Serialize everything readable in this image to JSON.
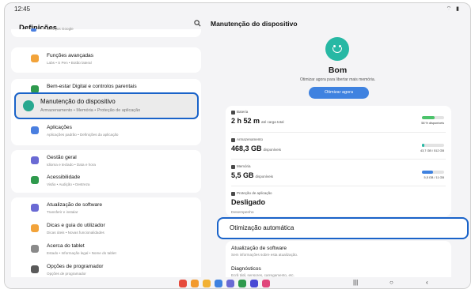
{
  "status_bar": {
    "time": "12:45",
    "icons": "⌔ ▮"
  },
  "left": {
    "title": "Definições",
    "search_icon": "search-icon",
    "items": [
      {
        "title": "",
        "subtitle": "Serviços Google",
        "color": "#4a7fe0"
      },
      {
        "title": "Funções avançadas",
        "subtitle": "Labs • S Pen • Botão lateral",
        "color": "#f2a33a"
      },
      {
        "title": "Bem-estar Digital e controlos parentais",
        "subtitle": "",
        "color": "#2f9a4d"
      },
      {
        "title": "Aplicações",
        "subtitle": "Aplicações padrão • Definições da aplicação",
        "color": "#4a7fe0"
      },
      {
        "title": "Gestão geral",
        "subtitle": "Idioma e teclado • Data e hora",
        "color": "#6a6ad4"
      },
      {
        "title": "Acessibilidade",
        "subtitle": "Visão • Audição • Destreza",
        "color": "#2f9a4d"
      },
      {
        "title": "Atualização de software",
        "subtitle": "Transferir e instalar",
        "color": "#6a6ad4"
      },
      {
        "title": "Dicas e guia do utilizador",
        "subtitle": "Dicas úteis • Novas funcionalidades",
        "color": "#f2a33a"
      },
      {
        "title": "Acerca do tablet",
        "subtitle": "Estado • Informação legal • Nome do tablet",
        "color": "#8a8a8a"
      },
      {
        "title": "Opções de programador",
        "subtitle": "Opções de programador",
        "color": "#5a5a5a"
      }
    ],
    "highlight": {
      "title": "Manutenção do dispositivo",
      "subtitle": "Armazenamento • Memória • Proteção de aplicação"
    }
  },
  "right": {
    "title": "Manutenção do dispositivo",
    "status": "Bom",
    "status_sub": "Otimizar agora para libertar mais memória.",
    "optimize_label": "Otimizar agora",
    "stats": [
      {
        "label": "Bateria",
        "value": "2 h 52 m",
        "unit": "até carga total",
        "right": "58 % disponíveis",
        "fill": 0.58,
        "color": "#4cc36b"
      },
      {
        "label": "Armazenamento",
        "value": "468,3 GB",
        "unit": "disponíveis",
        "right": "43,7 GB / 512 GB",
        "fill": 0.09,
        "color": "#27b8a4"
      },
      {
        "label": "Memória",
        "value": "5,5 GB",
        "unit": "disponíveis",
        "right": "5,5 GB / 11 GB",
        "fill": 0.5,
        "color": "#3f82e0"
      },
      {
        "label": "Proteção de aplicação",
        "value": "Desligado",
        "unit": "",
        "right": "",
        "fill": null,
        "color": ""
      }
    ],
    "section_label": "Desempenho",
    "auto_opt": "Otimização automática",
    "bottom_items": [
      {
        "title": "Atualização de software",
        "subtitle": "Sem informações sobre esta atualização."
      },
      {
        "title": "Diagnósticos",
        "subtitle": "Ecrã tátil, sensores, carregamento, etc."
      }
    ]
  },
  "taskbar": {
    "apps": [
      "#e64a3c",
      "#f29a2e",
      "#f2b134",
      "#3f82e0",
      "#6a6ad4",
      "#2f9a4d",
      "#4a4ad4",
      "#e0457b"
    ],
    "nav": [
      "|||",
      "○",
      "‹"
    ]
  }
}
